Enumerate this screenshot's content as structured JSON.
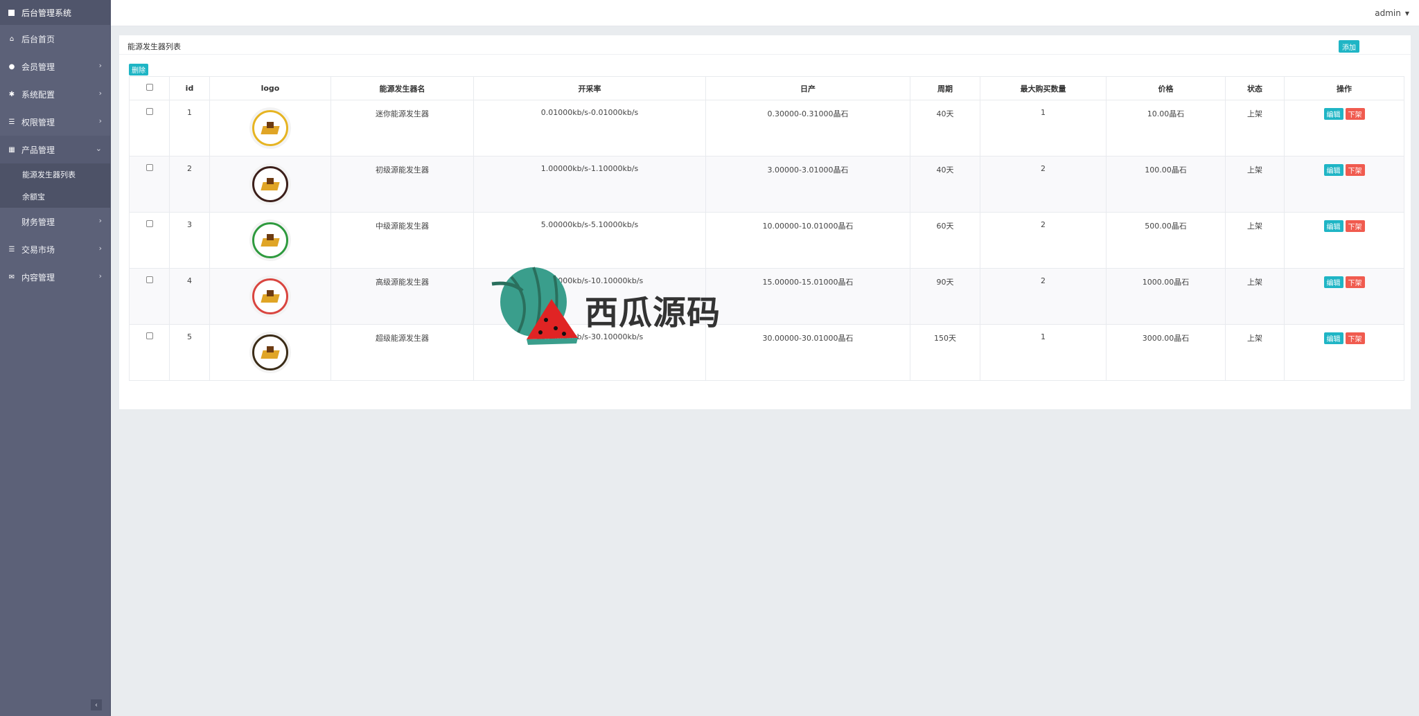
{
  "sidebar": {
    "brand": "后台管理系统",
    "items": [
      {
        "label": "后台首页",
        "icon": "home-icon",
        "glyph": "⌂",
        "chevron": false
      },
      {
        "label": "会员管理",
        "icon": "user-icon",
        "glyph": "●",
        "chevron": true
      },
      {
        "label": "系统配置",
        "icon": "cogs-icon",
        "glyph": "✱",
        "chevron": true
      },
      {
        "label": "权限管理",
        "icon": "list-icon",
        "glyph": "☰",
        "chevron": true
      }
    ],
    "open_item": {
      "label": "产品管理",
      "icon": "windows-icon",
      "glyph": "▦"
    },
    "sub_items": [
      "能源发生器列表",
      "余额宝"
    ],
    "items_after": [
      {
        "label": "财务管理",
        "icon": "",
        "glyph": "",
        "chevron": true
      },
      {
        "label": "交易市场",
        "icon": "list-icon",
        "glyph": "☰",
        "chevron": true
      },
      {
        "label": "内容管理",
        "icon": "envelope-icon",
        "glyph": "✉",
        "chevron": true
      }
    ]
  },
  "topbar": {
    "user": "admin"
  },
  "panel": {
    "title": "能源发生器列表",
    "add_label": "添加",
    "delete_label": "删除"
  },
  "table": {
    "headers": [
      "id",
      "logo",
      "能源发生器名",
      "开采率",
      "日产",
      "周期",
      "最大购买数量",
      "价格",
      "状态",
      "操作"
    ],
    "rows": [
      {
        "id": "1",
        "name": "迷你能源发生器",
        "rate": "0.01000kb/s-0.01000kb/s",
        "daily": "0.30000-0.31000晶石",
        "cycle": "40天",
        "max": "1",
        "price": "10.00晶石",
        "status": "上架",
        "ring": "#e6b422"
      },
      {
        "id": "2",
        "name": "初级源能发生器",
        "rate": "1.00000kb/s-1.10000kb/s",
        "daily": "3.00000-3.01000晶石",
        "cycle": "40天",
        "max": "2",
        "price": "100.00晶石",
        "status": "上架",
        "ring": "#3c1f1a"
      },
      {
        "id": "3",
        "name": "中级源能发生器",
        "rate": "5.00000kb/s-5.10000kb/s",
        "daily": "10.00000-10.01000晶石",
        "cycle": "60天",
        "max": "2",
        "price": "500.00晶石",
        "status": "上架",
        "ring": "#2e9a3e"
      },
      {
        "id": "4",
        "name": "高级源能发生器",
        "rate": "10.00000kb/s-10.10000kb/s",
        "daily": "15.00000-15.01000晶石",
        "cycle": "90天",
        "max": "2",
        "price": "1000.00晶石",
        "status": "上架",
        "ring": "#d9453f"
      },
      {
        "id": "5",
        "name": "超级能源发生器",
        "rate": "30.00000kb/s-30.10000kb/s",
        "daily": "30.00000-30.01000晶石",
        "cycle": "150天",
        "max": "1",
        "price": "3000.00晶石",
        "status": "上架",
        "ring": "#3b2c17"
      }
    ],
    "edit_label": "编辑",
    "off_label": "下架"
  },
  "watermark": {
    "text": "西瓜源码"
  },
  "colors": {
    "sidebar": "#5c6178",
    "teal": "#1fb5c5",
    "red": "#f05b4f"
  }
}
